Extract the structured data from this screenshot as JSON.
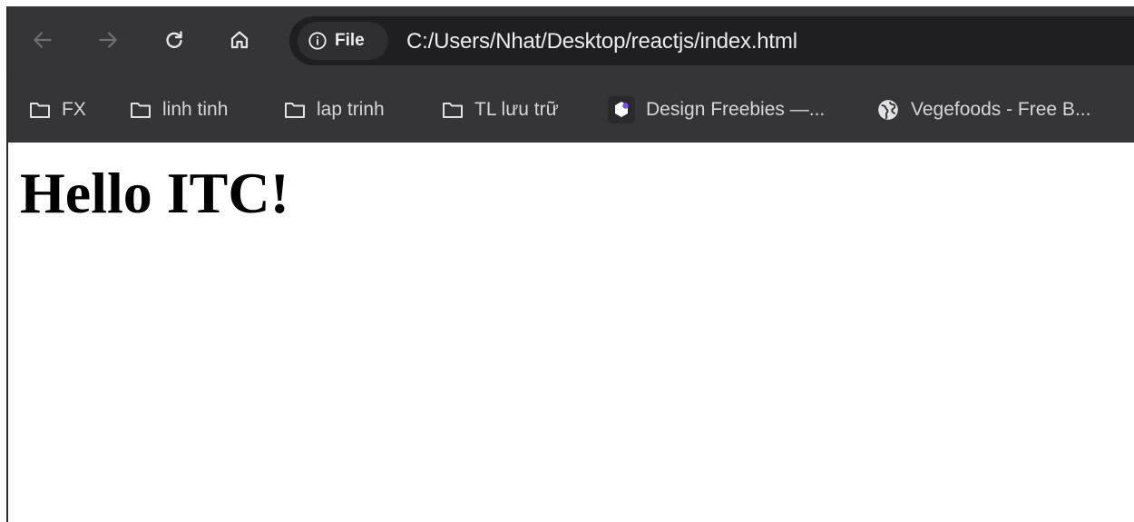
{
  "toolbar": {
    "back_icon": "arrow-left-icon",
    "forward_icon": "arrow-right-icon",
    "reload_icon": "reload-icon",
    "home_icon": "home-icon"
  },
  "omnibox": {
    "chip_icon": "info-icon",
    "chip_label": "File",
    "url": "C:/Users/Nhat/Desktop/reactjs/index.html"
  },
  "bookmarks": [
    {
      "icon": "folder-icon",
      "label": "FX"
    },
    {
      "icon": "folder-icon",
      "label": "linh tinh"
    },
    {
      "icon": "folder-icon",
      "label": "lap trinh"
    },
    {
      "icon": "folder-icon",
      "label": "TL lưu trữ"
    },
    {
      "icon": "design-freebies-favicon-icon",
      "label": "Design Freebies —..."
    },
    {
      "icon": "globe-icon",
      "label": "Vegefoods - Free B..."
    }
  ],
  "page": {
    "heading": "Hello ITC!"
  },
  "colors": {
    "chrome_background": "#353537",
    "omnibox_background": "#1f1f21",
    "chip_background": "#2f2f31",
    "chrome_text": "#d6d6d6",
    "page_background": "#ffffff",
    "heading_text": "#000000",
    "favicon_accent": "#7b4dff"
  }
}
